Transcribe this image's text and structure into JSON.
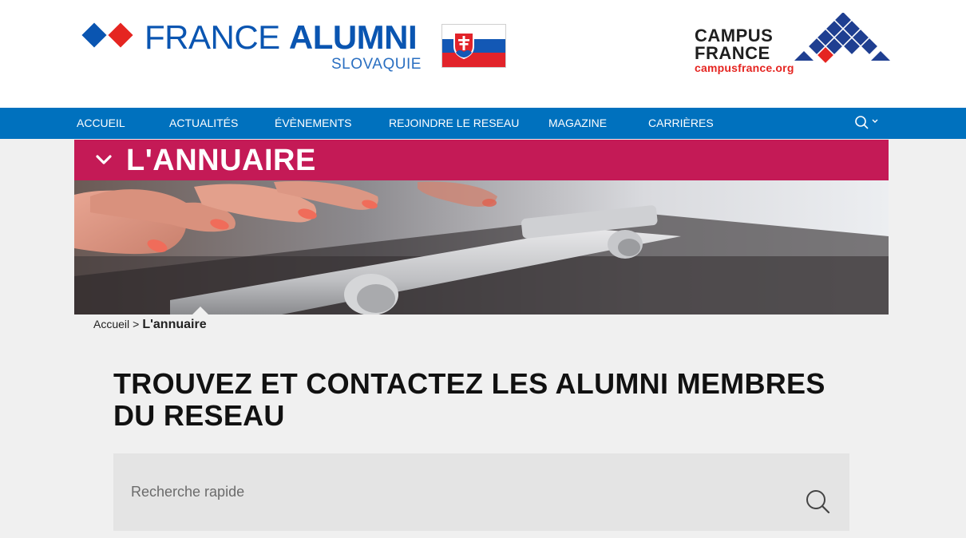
{
  "header": {
    "logo_brand_light": "FRANCE ",
    "logo_brand_bold": "ALUMNI",
    "logo_country": "SLOVAQUIE",
    "campus_logo_line1": "CAMPUS",
    "campus_logo_line2": "FRANCE",
    "campus_logo_url": "campusfrance.org"
  },
  "nav": {
    "items": [
      {
        "label": "ACCUEIL"
      },
      {
        "label": "ACTUALITÉS"
      },
      {
        "label": "ÉVÈNEMENTS"
      },
      {
        "label": "REJOINDRE LE RESEAU"
      },
      {
        "label": "MAGAZINE"
      },
      {
        "label": "CARRIÈRES"
      }
    ],
    "search_icon": "search-icon"
  },
  "section": {
    "title": "L'ANNUAIRE"
  },
  "breadcrumb": {
    "home": "Accueil",
    "separator": ">",
    "current": "L'annuaire"
  },
  "main": {
    "heading": "TROUVEZ ET CONTACTEZ LES ALUMNI MEMBRES DU RESEAU",
    "search_placeholder": "Recherche rapide"
  },
  "colors": {
    "brand_blue": "#0a55b1",
    "nav_blue": "#0071be",
    "section_magenta": "#c41a56",
    "campus_red": "#e52521",
    "campus_navy": "#1f3f91"
  }
}
